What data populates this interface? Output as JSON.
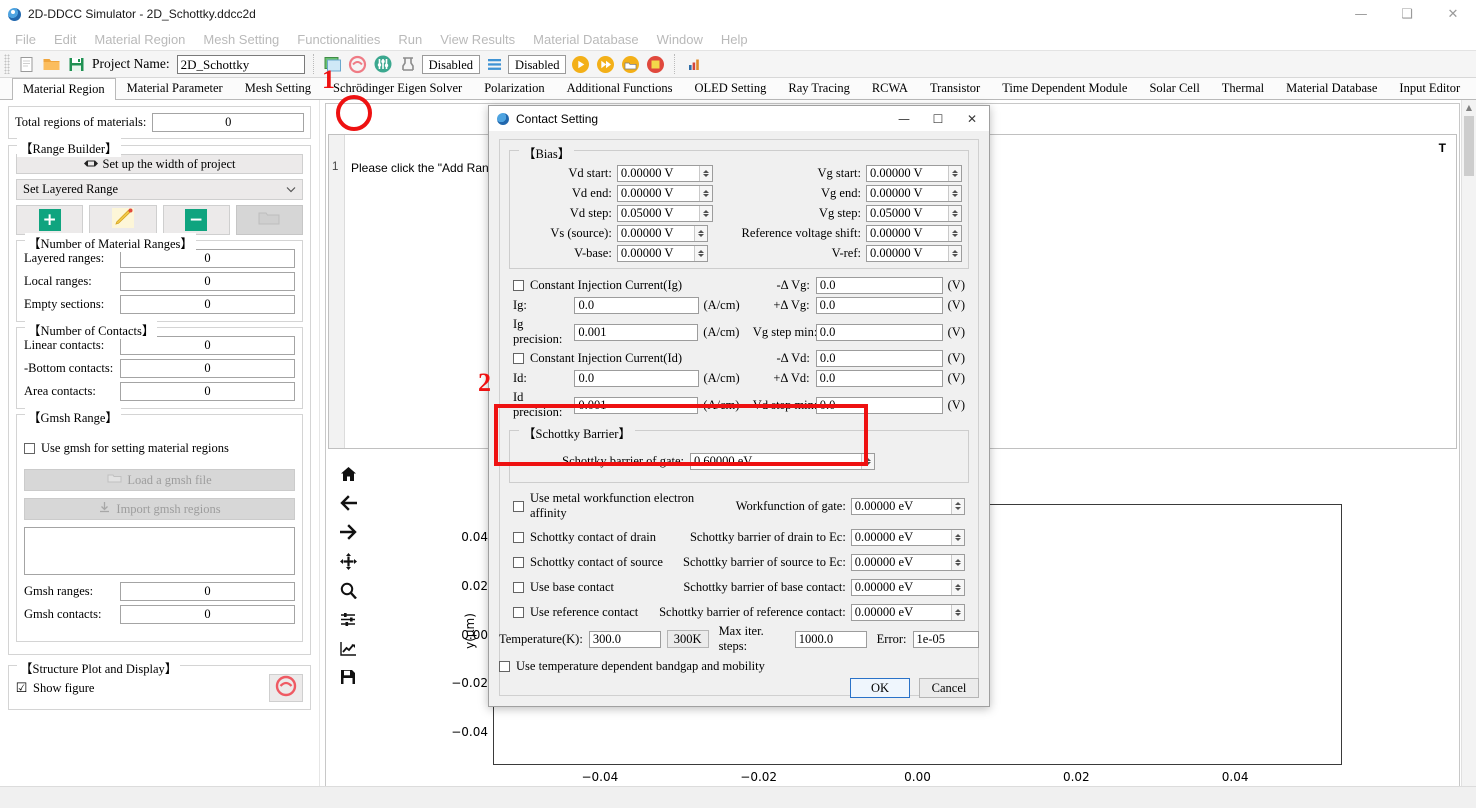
{
  "window": {
    "title": "2D-DDCC Simulator - 2D_Schottky.ddcc2d",
    "minimize": "—",
    "maximize": "❑",
    "close": "✕"
  },
  "menubar": {
    "items": [
      "File",
      "Edit",
      "Material Region",
      "Mesh Setting",
      "Functionalities",
      "Run",
      "View Results",
      "Material Database",
      "Window",
      "Help"
    ]
  },
  "toolbar": {
    "project_label": "Project Name:",
    "project_value": "2D_Schottky",
    "disabled_1": "Disabled",
    "disabled_2": "Disabled"
  },
  "tabs": {
    "items": [
      "Material Region",
      "Material Parameter",
      "Mesh Setting",
      "Schrödinger Eigen Solver",
      "Polarization",
      "Additional Functions",
      "OLED Setting",
      "Ray Tracing",
      "RCWA",
      "Transistor",
      "Time Dependent Module",
      "Solar Cell",
      "Thermal",
      "Material Database",
      "Input Editor"
    ],
    "active": "Material Region"
  },
  "sidebar": {
    "total_regions_label": "Total regions of materials:",
    "total_regions_value": "0",
    "range_builder_title": "【Range Builder】",
    "setup_width_btn": "Set up the width of project",
    "layered_range_combo": "Set Layered Range",
    "material_ranges_title": "【Number of Material Ranges】",
    "layered_ranges_label": "Layered ranges:",
    "layered_ranges_value": "0",
    "local_ranges_label": "Local ranges:",
    "local_ranges_value": "0",
    "empty_sections_label": "Empty sections:",
    "empty_sections_value": "0",
    "contacts_title": "【Number of Contacts】",
    "linear_contacts_label": "Linear contacts:",
    "linear_contacts_value": "0",
    "bottom_contacts_label": "-Bottom contacts:",
    "bottom_contacts_value": "0",
    "area_contacts_label": "Area contacts:",
    "area_contacts_value": "0",
    "gmsh_range_title": "【Gmsh Range】",
    "use_gmsh_label": "Use gmsh for setting material regions",
    "load_gmsh_btn": "Load a gmsh file",
    "import_gmsh_btn": "Import gmsh regions",
    "gmsh_ranges_label": "Gmsh ranges:",
    "gmsh_ranges_value": "0",
    "gmsh_contacts_label": "Gmsh contacts:",
    "gmsh_contacts_value": "0",
    "structure_plot_title": "【Structure Plot and Display】",
    "show_figure_label": "Show figure",
    "show_figure_checked": "☑"
  },
  "editor": {
    "header": "T",
    "line_number": "1",
    "line_text": "Please click the \"Add Range"
  },
  "plot_toolbar": {
    "items": [
      "home-icon",
      "back-arrow-icon",
      "forward-arrow-icon",
      "pan-move-icon",
      "zoom-magnifier-icon",
      "configure-subplots-icon",
      "curve-settings-icon",
      "save-floppy-icon"
    ]
  },
  "chart_data": {
    "type": "scatter",
    "title": "",
    "xlabel": "",
    "ylabel": "y(μm)",
    "x_ticks": [
      "−0.04",
      "−0.02",
      "0.00",
      "0.02",
      "0.04"
    ],
    "y_ticks": [
      "0.04",
      "0.02",
      "0.00",
      "−0.02",
      "−0.04"
    ],
    "xlim": [
      -0.05,
      0.05
    ],
    "ylim": [
      -0.05,
      0.05
    ],
    "grid": false,
    "series": [],
    "values": []
  },
  "dialog": {
    "title": "Contact Setting",
    "minimize": "—",
    "maximize": "☐",
    "close": "✕",
    "bias": {
      "legend": "【Bias】",
      "vd_start_label": "Vd start:",
      "vd_start_value": "0.00000 V",
      "vd_end_label": "Vd end:",
      "vd_end_value": "0.00000 V",
      "vd_step_label": "Vd step:",
      "vd_step_value": "0.05000 V",
      "vs_source_label": "Vs (source):",
      "vs_source_value": "0.00000 V",
      "vbase_label": "V-base:",
      "vbase_value": "0.00000 V",
      "vg_start_label": "Vg start:",
      "vg_start_value": "0.00000 V",
      "vg_end_label": "Vg end:",
      "vg_end_value": "0.00000 V",
      "vg_step_label": "Vg step:",
      "vg_step_value": "0.05000 V",
      "ref_shift_label": "Reference voltage shift:",
      "ref_shift_value": "0.00000 V",
      "vref_label": "V-ref:",
      "vref_value": "0.00000 V"
    },
    "injection": {
      "const_ig_label": "Constant Injection Current(Ig)",
      "minus_dvg_label": "-Δ Vg:",
      "minus_dvg_value": "0.0",
      "ig_label": "Ig:",
      "ig_value": "0.0",
      "ig_unit": "(A/cm)",
      "plus_dvg_label": "+Δ Vg:",
      "plus_dvg_value": "0.0",
      "ig_precision_label": "Ig precision:",
      "ig_precision_value": "0.001",
      "ig_precision_unit": "(A/cm)",
      "vg_step_min_label": "Vg step min:",
      "vg_step_min_value": "0.0",
      "const_id_label": "Constant Injection Current(Id)",
      "minus_dvd_label": "-Δ Vd:",
      "minus_dvd_value": "0.0",
      "id_label": "Id:",
      "id_value": "0.0",
      "id_unit": "(A/cm)",
      "plus_dvd_label": "+Δ Vd:",
      "plus_dvd_value": "0.0",
      "id_precision_label": "Id precision:",
      "id_precision_value": "0.001",
      "id_precision_unit": "(A/cm)",
      "vd_step_min_label": "Vd step min:",
      "vd_step_min_value": "0.0",
      "volt_unit": "(V)"
    },
    "schottky": {
      "legend": "【Schottky Barrier】",
      "gate_barrier_label": "Schottky barrier of gate:",
      "gate_barrier_value": "0.60000 eV",
      "use_workfunction_label": "Use metal workfunction  electron affinity",
      "workfunction_gate_label": "Workfunction of gate:",
      "workfunction_gate_value": "0.00000 eV",
      "contact_drain_label": "Schottky contact of drain",
      "barrier_drain_label": "Schottky barrier of drain to Ec:",
      "barrier_drain_value": "0.00000 eV",
      "contact_source_label": "Schottky contact of source",
      "barrier_source_label": "Schottky barrier of source to Ec:",
      "barrier_source_value": "0.00000 eV",
      "use_base_label": "Use base contact",
      "barrier_base_label": "Schottky barrier of base contact:",
      "barrier_base_value": "0.00000 eV",
      "use_reference_label": "Use reference contact",
      "barrier_reference_label": "Schottky barrier of reference contact:",
      "barrier_reference_value": "0.00000 eV"
    },
    "footer": {
      "temperature_label": "Temperature(K):",
      "temperature_value": "300.0",
      "temperature_btn": "300K",
      "max_iter_label": "Max iter. steps:",
      "max_iter_value": "1000.0",
      "error_label": "Error:",
      "error_value": "1e-05",
      "temp_dependent_label": "Use temperature dependent bandgap and mobility",
      "ok_label": "OK",
      "cancel_label": "Cancel"
    }
  },
  "annotations": {
    "marker_1": "1",
    "marker_2": "2",
    "highlight_color": "#ee1111"
  }
}
